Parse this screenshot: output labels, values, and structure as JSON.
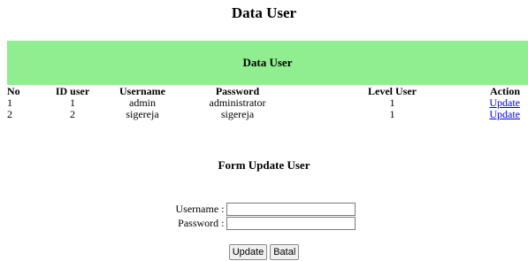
{
  "page_title": "Data User",
  "table": {
    "caption": "Data User",
    "banner_color": "#90ee90",
    "headers": {
      "no": "No",
      "id_user": "ID user",
      "username": "Username",
      "password": "Password",
      "level_user": "Level User",
      "action": "Action"
    },
    "rows": [
      {
        "no": "1",
        "id_user": "1",
        "username": "admin",
        "password": "administrator",
        "level_user": "1",
        "action": "Update"
      },
      {
        "no": "2",
        "id_user": "2",
        "username": "sigereja",
        "password": "sigereja",
        "level_user": "1",
        "action": "Update"
      }
    ]
  },
  "form": {
    "title": "Form Update User",
    "username_label": "Username :",
    "username_value": "",
    "password_label": "Password :",
    "password_value": "",
    "submit_label": "Update",
    "cancel_label": "Batal"
  },
  "link_color": "#0000ee"
}
